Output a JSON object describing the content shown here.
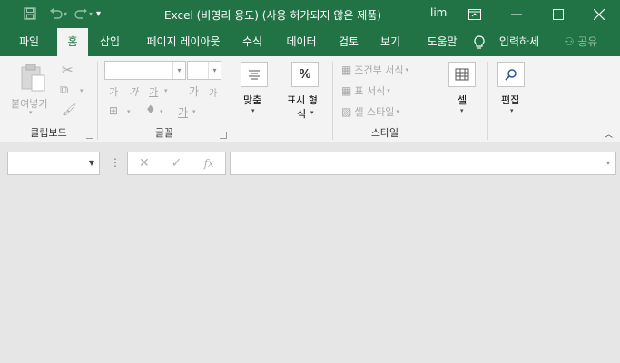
{
  "titlebar": {
    "title": "Excel (비영리 용도) (사용 허가되지 않은 제품)",
    "user": "lim",
    "customize_icon": "▾"
  },
  "tabs": [
    {
      "label": "파일"
    },
    {
      "label": "홈"
    },
    {
      "label": "삽입"
    },
    {
      "label": "페이지 레이아웃"
    },
    {
      "label": "수식"
    },
    {
      "label": "데이터"
    },
    {
      "label": "검토"
    },
    {
      "label": "보기"
    },
    {
      "label": "도움말"
    },
    {
      "label": "입력하세"
    },
    {
      "label": "공유"
    }
  ],
  "ribbon": {
    "clipboard": {
      "label": "클립보드",
      "paste": "붙여넣기"
    },
    "font": {
      "label": "글꼴",
      "increase": "가",
      "decrease": "가",
      "bold": "가",
      "italic": "가",
      "underline": "가",
      "font_color": "가"
    },
    "alignment": {
      "label": "맞춤"
    },
    "number": {
      "label": "표시 형식",
      "line1": "표시 형",
      "line2": "식",
      "icon": "%"
    },
    "styles": {
      "label": "스타일",
      "conditional": "조건부 서식",
      "table": "표 서식",
      "cell_style": "셀 스타일"
    },
    "cells": {
      "label": "셀"
    },
    "editing": {
      "label": "편집"
    }
  },
  "formula_bar": {
    "dots": "⋮",
    "cancel": "✕",
    "enter": "✓",
    "fx": "fx"
  },
  "colors": {
    "accent": "#217346",
    "ribbon_bg": "#f3f3f3",
    "workspace_bg": "#e6e6e6"
  }
}
